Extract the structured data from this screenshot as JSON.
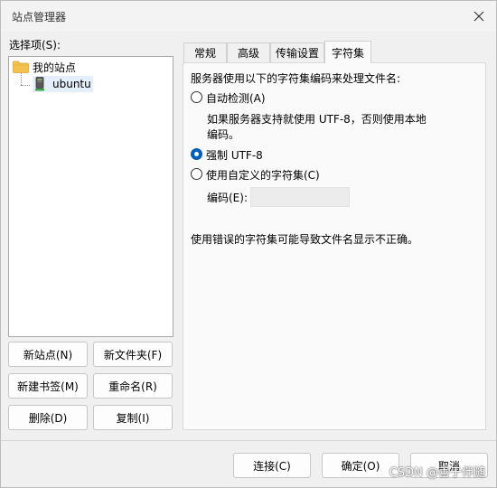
{
  "window": {
    "title": "站点管理器"
  },
  "left": {
    "select_label": "选择项(S):",
    "tree": {
      "root": "我的站点",
      "child": "ubuntu"
    },
    "buttons": {
      "new_site": "新站点(N)",
      "new_folder": "新文件夹(F)",
      "new_bookmark": "新建书签(M)",
      "rename": "重命名(R)",
      "delete": "删除(D)",
      "duplicate": "复制(I)"
    }
  },
  "tabs": [
    {
      "label": "常规"
    },
    {
      "label": "高级"
    },
    {
      "label": "传输设置"
    },
    {
      "label": "字符集",
      "active": true
    }
  ],
  "charset": {
    "heading": "服务器使用以下的字符集编码来处理文件名:",
    "auto": {
      "label": "自动检测(A)",
      "checked": false
    },
    "auto_desc_line1": "如果服务器支持就使用 UTF-8，否则使用本地",
    "auto_desc_line2": "编码。",
    "force": {
      "label": "强制 UTF-8",
      "checked": true
    },
    "custom": {
      "label": "使用自定义的字符集(C)",
      "checked": false
    },
    "encoding_label": "编码(E):",
    "encoding_value": "",
    "warning": "使用错误的字符集可能导致文件名显示不正确。"
  },
  "footer": {
    "connect": "连接(C)",
    "ok": "确定(O)",
    "cancel": "取消"
  },
  "watermark": "CSDN @善于伴随",
  "colors": {
    "accent": "#005fb8",
    "folder": "#f2c14e"
  }
}
